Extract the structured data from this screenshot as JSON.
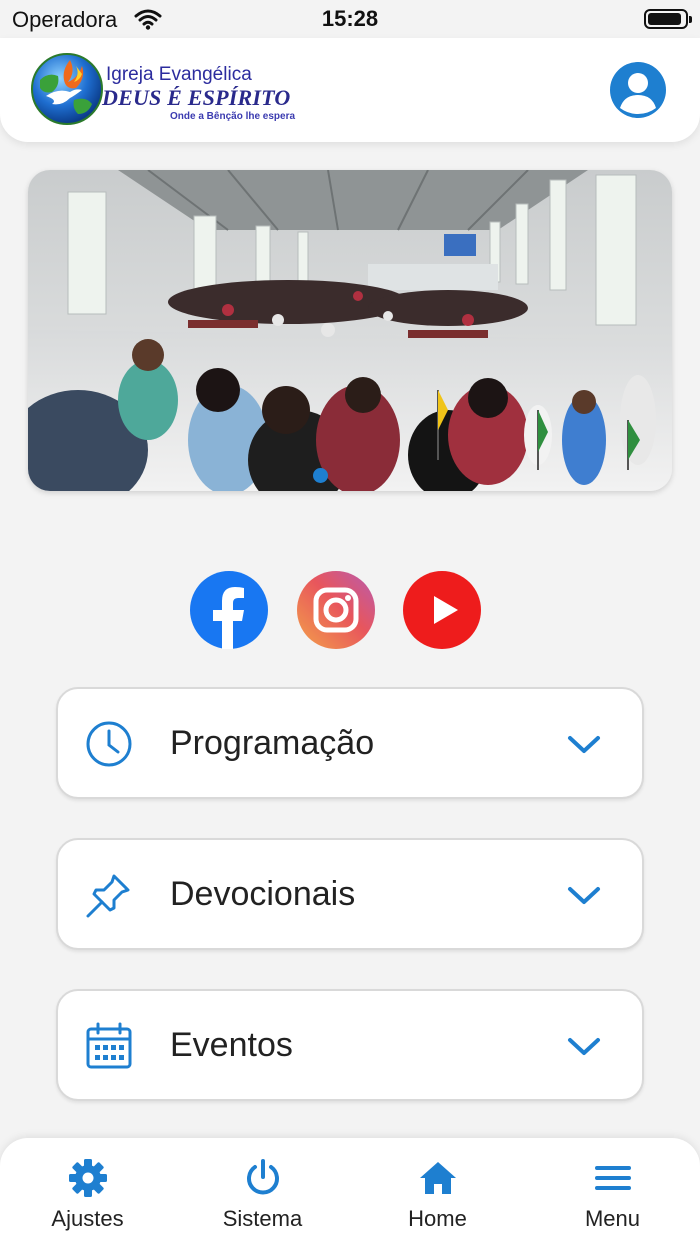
{
  "status_bar": {
    "carrier": "Operadora",
    "time": "15:28",
    "battery_level": 0.92
  },
  "header": {
    "logo": {
      "line1": "Igreja Evangélica",
      "line2": "DEUS É ESPÍRITO",
      "tagline": "Onde a Bênção lhe espera"
    },
    "profile_icon": "user-circle-icon"
  },
  "banner": {
    "image": "church-congregation-photo",
    "slide_count": 1,
    "active_slide": 1
  },
  "social": [
    {
      "name": "Facebook",
      "icon": "facebook-icon",
      "color": "#1877F2"
    },
    {
      "name": "Instagram",
      "icon": "instagram-icon",
      "color": "#E8565C"
    },
    {
      "name": "YouTube",
      "icon": "youtube-icon",
      "color": "#EE1C1C"
    }
  ],
  "sections": [
    {
      "label": "Programação",
      "icon": "clock-icon"
    },
    {
      "label": "Devocionais",
      "icon": "pushpin-icon"
    },
    {
      "label": "Eventos",
      "icon": "calendar-icon"
    }
  ],
  "bottom_nav": [
    {
      "label": "Ajustes",
      "icon": "gear-icon"
    },
    {
      "label": "Sistema",
      "icon": "power-icon"
    },
    {
      "label": "Home",
      "icon": "home-icon"
    },
    {
      "label": "Menu",
      "icon": "hamburger-menu-icon"
    }
  ],
  "colors": {
    "accent": "#1E7FD0",
    "background": "#F3F3F3",
    "logo_text": "#2A2A8C"
  }
}
